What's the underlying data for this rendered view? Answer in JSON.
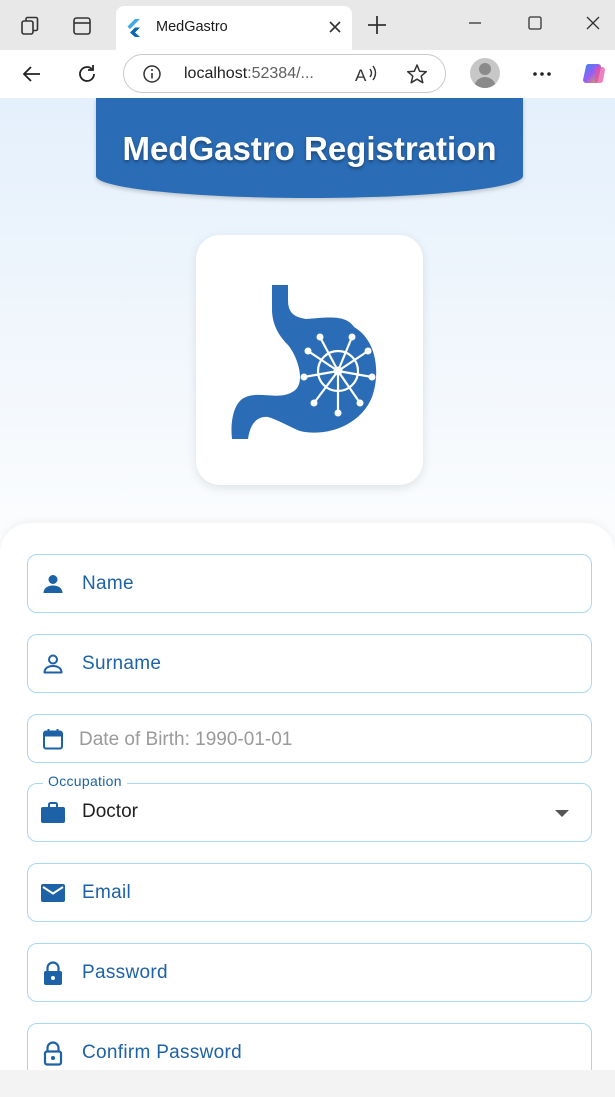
{
  "browser": {
    "tab_title": "MedGastro",
    "url_host": "localhost",
    "url_rest": ":52384/..."
  },
  "app": {
    "title": "MedGastro Registration",
    "accent_color": "#2a6cb5",
    "label_color": "#1d62a6",
    "fields": {
      "name_label": "Name",
      "surname_label": "Surname",
      "dob_placeholder": "Date of Birth: 1990-01-01",
      "occupation_label": "Occupation",
      "occupation_value": "Doctor",
      "email_label": "Email",
      "password_label": "Password",
      "confirm_password_label": "Confirm Password"
    },
    "icons": {
      "name": "person-filled-icon",
      "surname": "person-outline-icon",
      "dob": "calendar-icon",
      "occupation": "briefcase-icon",
      "email": "mail-icon",
      "password": "lock-icon",
      "confirm_password": "lock-outline-icon"
    }
  }
}
